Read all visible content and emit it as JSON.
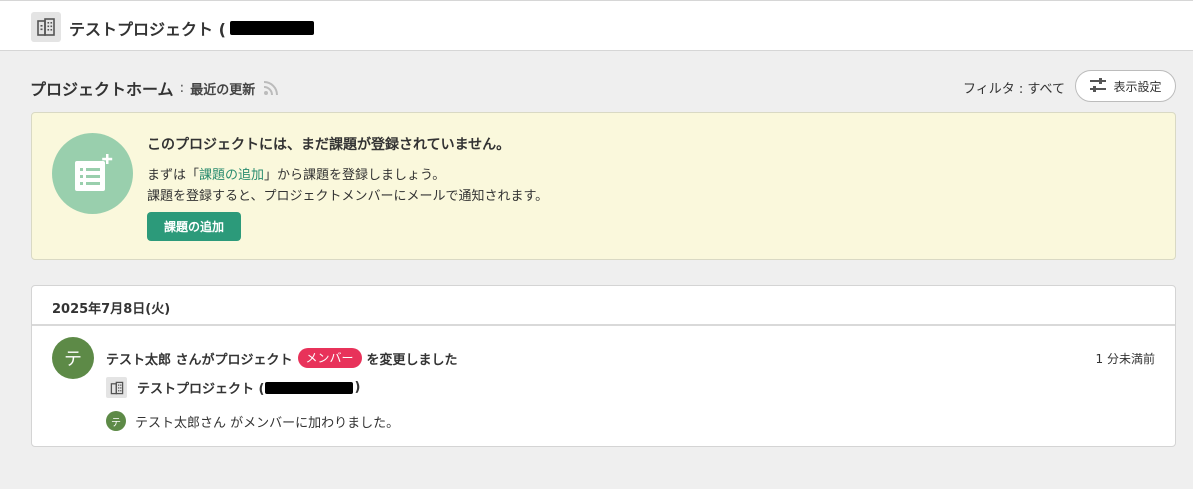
{
  "header": {
    "project_title": "テストプロジェクト (",
    "icon": "building-icon"
  },
  "subhead": {
    "title": "プロジェクトホーム",
    "separator": ":",
    "subtitle": "最近の更新",
    "rss_icon": "rss-icon"
  },
  "toolbar": {
    "filter_label": "フィルタ : すべて",
    "settings_label": "表示設定",
    "settings_icon": "sliders-icon"
  },
  "notice": {
    "icon": "add-list-icon",
    "title": "このプロジェクトには、まだ課題が登録されていません。",
    "line1_prefix": "まずは「",
    "line1_link": "課題の追加",
    "line1_suffix": "」から課題を登録しましょう。",
    "line2": "課題を登録すると、プロジェクトメンバーにメールで通知されます。",
    "add_button": "課題の追加",
    "colors": {
      "background": "#faf8dc",
      "circle": "#99cfad",
      "button": "#2c9a7a",
      "link": "#2a8c6f"
    }
  },
  "activity": {
    "date": "2025年7月8日(火)",
    "items": [
      {
        "avatar_initial": "テ",
        "text_before": "テスト太郎 さんがプロジェクト",
        "badge": "メンバー",
        "text_after": "を変更しました",
        "time": "1 分未満前",
        "project_name_prefix": "テストプロジェクト (",
        "project_name_suffix": ")",
        "member_initial": "テ",
        "member_text": "テスト太郎さん がメンバーに加わりました。"
      }
    ],
    "colors": {
      "badge": "#e8325a",
      "avatar": "#5d8a47"
    }
  }
}
